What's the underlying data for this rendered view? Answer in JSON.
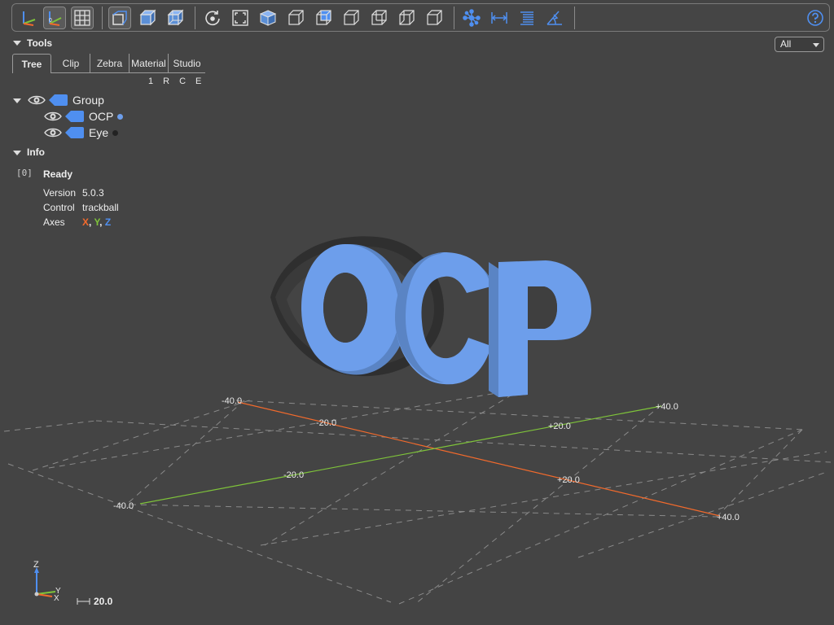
{
  "toolbar": {
    "buttons": [
      {
        "name": "axes-icon"
      },
      {
        "name": "axes-origin-icon"
      },
      {
        "name": "grid-icon"
      },
      {
        "name": "perspective-icon"
      },
      {
        "name": "transparent-icon"
      },
      {
        "name": "black-edges-icon"
      },
      {
        "name": "reset-view-icon"
      },
      {
        "name": "resize-icon"
      },
      {
        "name": "iso-view-icon"
      },
      {
        "name": "front-view-icon"
      },
      {
        "name": "rear-view-icon"
      },
      {
        "name": "top-view-icon"
      },
      {
        "name": "bottom-view-icon"
      },
      {
        "name": "left-view-icon"
      },
      {
        "name": "right-view-icon"
      },
      {
        "name": "explode-icon"
      },
      {
        "name": "distance-measure-icon"
      },
      {
        "name": "properties-icon"
      },
      {
        "name": "angle-measure-icon"
      },
      {
        "name": "help-icon"
      }
    ]
  },
  "tools": {
    "title": "Tools",
    "tabs": [
      "Tree",
      "Clip",
      "Zebra",
      "Material",
      "Studio"
    ],
    "active_tab": "Tree",
    "subheader": [
      "1",
      "R",
      "C",
      "E"
    ]
  },
  "view_select": {
    "value": "All"
  },
  "tree": {
    "items": [
      {
        "label": "Group",
        "level": 0
      },
      {
        "label": "OCP",
        "level": 1,
        "dot_color": "#6d9eeb"
      },
      {
        "label": "Eye",
        "level": 1,
        "dot_color": "#222222"
      }
    ]
  },
  "info": {
    "title": "Info",
    "index": "[0]",
    "status": "Ready",
    "rows": [
      {
        "key": "Version",
        "value": "5.0.3"
      },
      {
        "key": "Control",
        "value": "trackball"
      },
      {
        "key": "Axes",
        "value": ""
      }
    ],
    "axes": {
      "x": "X",
      "y": "Y",
      "z": "Z",
      "sep": ", "
    },
    "axis_colors": {
      "x": "#f26a2c",
      "y": "#7fc43a",
      "z": "#4f8ff0"
    }
  },
  "grid_labels": {
    "x_neg40": "-40.0",
    "x_neg20": "-20.0",
    "x_pos20": "+20.0",
    "x_pos40": "+40.0",
    "y_neg40": "-40.0",
    "y_neg20": "-20.0",
    "y_pos20": "+20.0",
    "y_pos40": "+40.0"
  },
  "axes_gizmo": {
    "z": "Z",
    "y": "Y",
    "x": "X"
  },
  "scale_bar": {
    "value": "20.0"
  },
  "colors": {
    "background": "#444444",
    "model_blue": "#6d9eeb",
    "eye_dark": "#3a3a3a",
    "x_axis": "#f26a2c",
    "y_axis": "#7fc43a",
    "accent": "#4f8ff0"
  }
}
